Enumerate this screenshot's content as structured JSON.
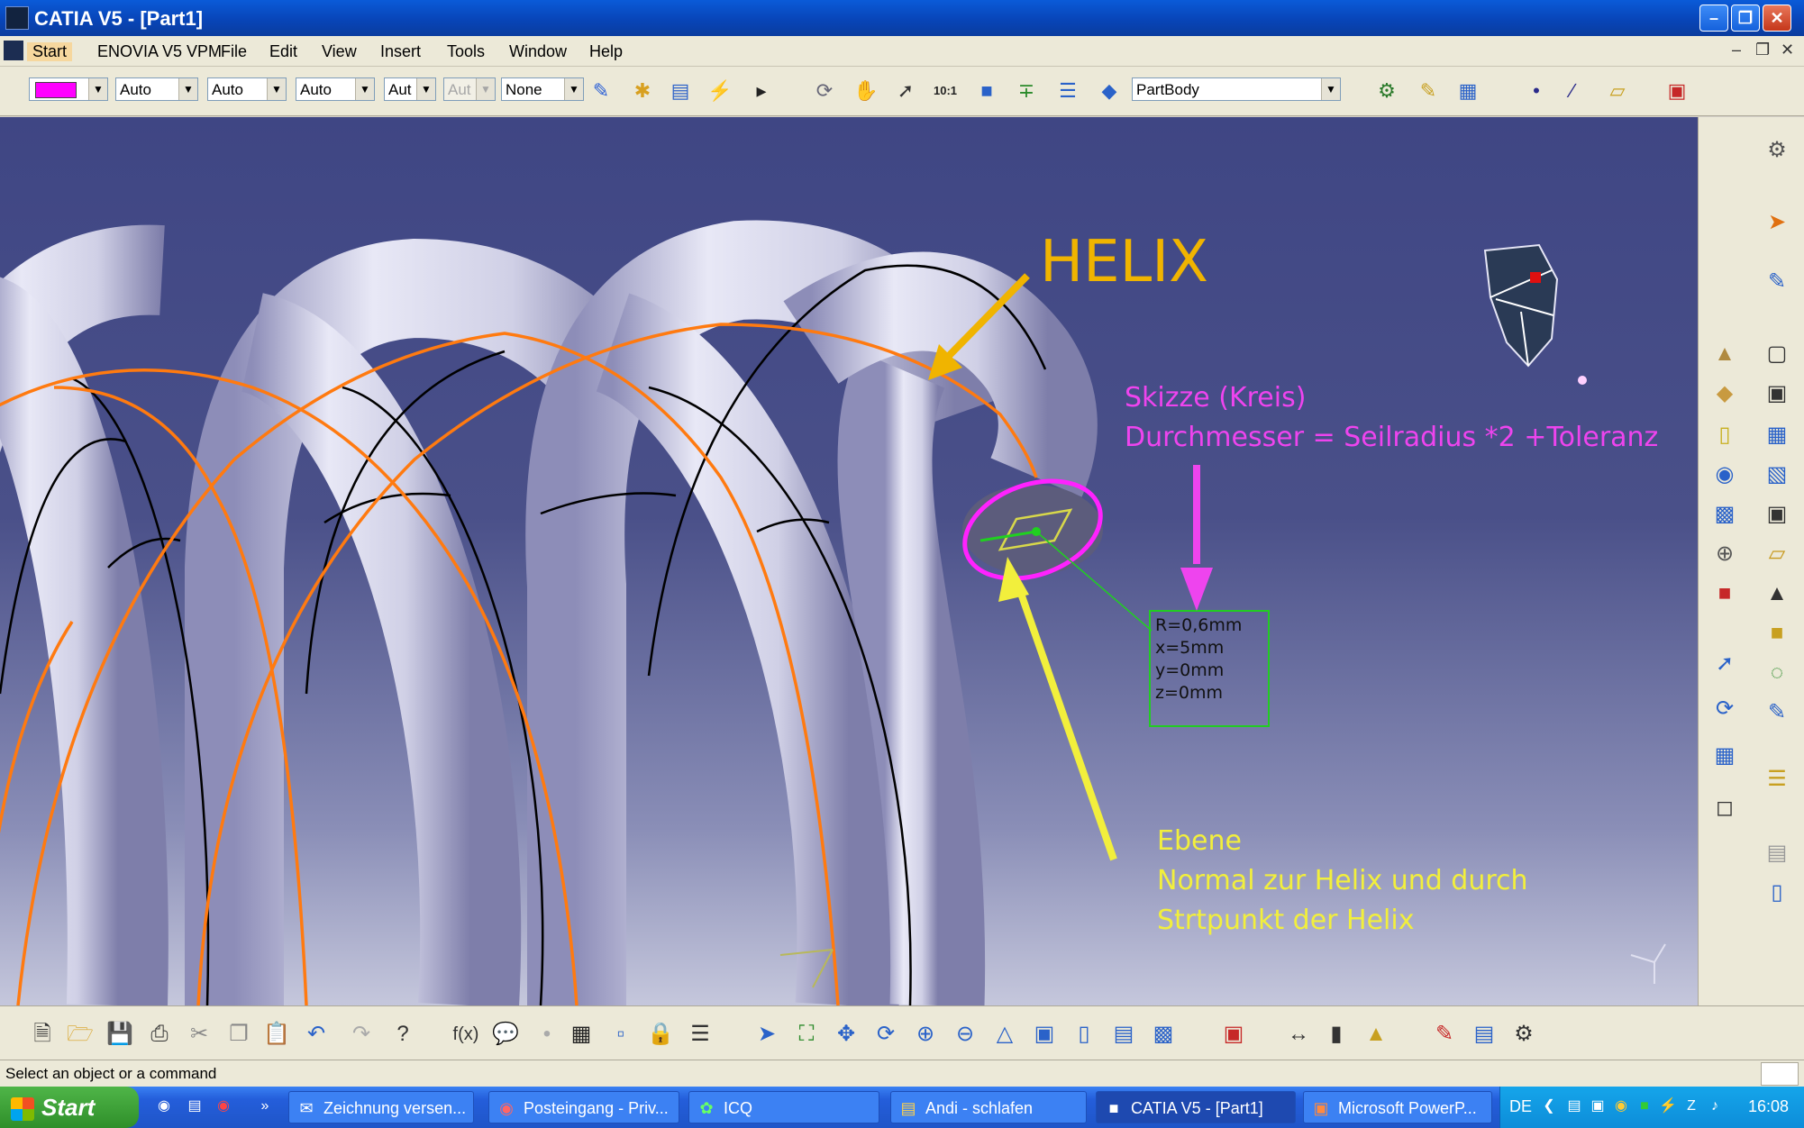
{
  "window": {
    "title": "CATIA V5 - [Part1]"
  },
  "menu": {
    "items": [
      "Start",
      "ENOVIA V5 VPM",
      "File",
      "Edit",
      "View",
      "Insert",
      "Tools",
      "Window",
      "Help"
    ]
  },
  "toolbar": {
    "color_swatch": "#ff00ff",
    "combo1": "Auto",
    "combo2": "Auto",
    "combo3": "Auto",
    "combo4": "Aut",
    "combo5": "Aut",
    "combo6": "None",
    "body_select": "PartBody"
  },
  "annotations": {
    "helix_label": "HELIX",
    "sketch_line1": "Skizze (Kreis)",
    "sketch_line2": "Durchmesser = Seilradius *2 +Toleranz",
    "plane_line1": "Ebene",
    "plane_line2": "Normal zur Helix und durch",
    "plane_line3": "Strtpunkt der Helix",
    "info_r": "R=0,6mm",
    "info_x": "x=5mm",
    "info_y": "y=0mm",
    "info_z": "z=0mm"
  },
  "colors": {
    "helix_text": "#f0b400",
    "sketch_text": "#ee44ee",
    "plane_text": "#f2ef3c",
    "tube": "#dcdcf0",
    "helix_curve": "#ff7a10"
  },
  "status": {
    "message": "Select an object or a command"
  },
  "taskbar": {
    "start_label": "Start",
    "tasks": [
      {
        "label": "Zeichnung versen...",
        "icon": "mail-icon"
      },
      {
        "label": "Posteingang - Priv...",
        "icon": "outlook-icon"
      },
      {
        "label": "ICQ",
        "icon": "icq-icon"
      },
      {
        "label": "Andi - schlafen",
        "icon": "folder-icon"
      },
      {
        "label": "CATIA V5 - [Part1]",
        "icon": "catia-icon"
      },
      {
        "label": "Microsoft PowerP...",
        "icon": "powerpoint-icon"
      }
    ],
    "language": "DE",
    "clock": "16:08"
  }
}
